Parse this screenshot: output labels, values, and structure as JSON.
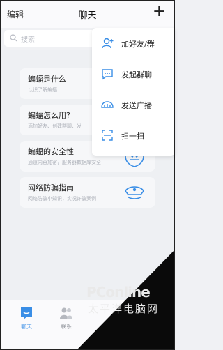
{
  "header": {
    "edit_label": "编辑",
    "title": "聊天",
    "add_icon": "plus-icon"
  },
  "search": {
    "placeholder": "搜索"
  },
  "cards": [
    {
      "title": "蝙蝠是什么",
      "subtitle": "认识了解蝙蝠",
      "icon": "illustration"
    },
    {
      "title": "蝙蝠怎么用?",
      "subtitle": "添加好友、创建群聊、发",
      "icon": "illustration"
    },
    {
      "title": "蝙蝠的安全性",
      "subtitle": "通道内容加密，服务器数据库安全",
      "icon": "shield-icon"
    },
    {
      "title": "网络防骗指南",
      "subtitle": "网络防骗小知识，实况诈骗案例",
      "icon": "police-hat-icon"
    }
  ],
  "menu": {
    "items": [
      {
        "label": "加好友/群",
        "icon": "add-friend-icon"
      },
      {
        "label": "发起群聊",
        "icon": "group-chat-icon"
      },
      {
        "label": "发送广播",
        "icon": "broadcast-icon"
      },
      {
        "label": "扫一扫",
        "icon": "scan-icon"
      }
    ]
  },
  "tabbar": {
    "tabs": [
      {
        "label": "聊天",
        "icon": "chat-tab-icon",
        "active": true
      },
      {
        "label": "联系",
        "icon": "contacts-tab-icon",
        "active": false
      }
    ]
  },
  "watermark": {
    "brand": "PConline",
    "sub": "太平洋电脑网"
  },
  "colors": {
    "accent": "#3a8ee6",
    "background": "#f0f1f4",
    "menu_bg": "#ffffff"
  }
}
